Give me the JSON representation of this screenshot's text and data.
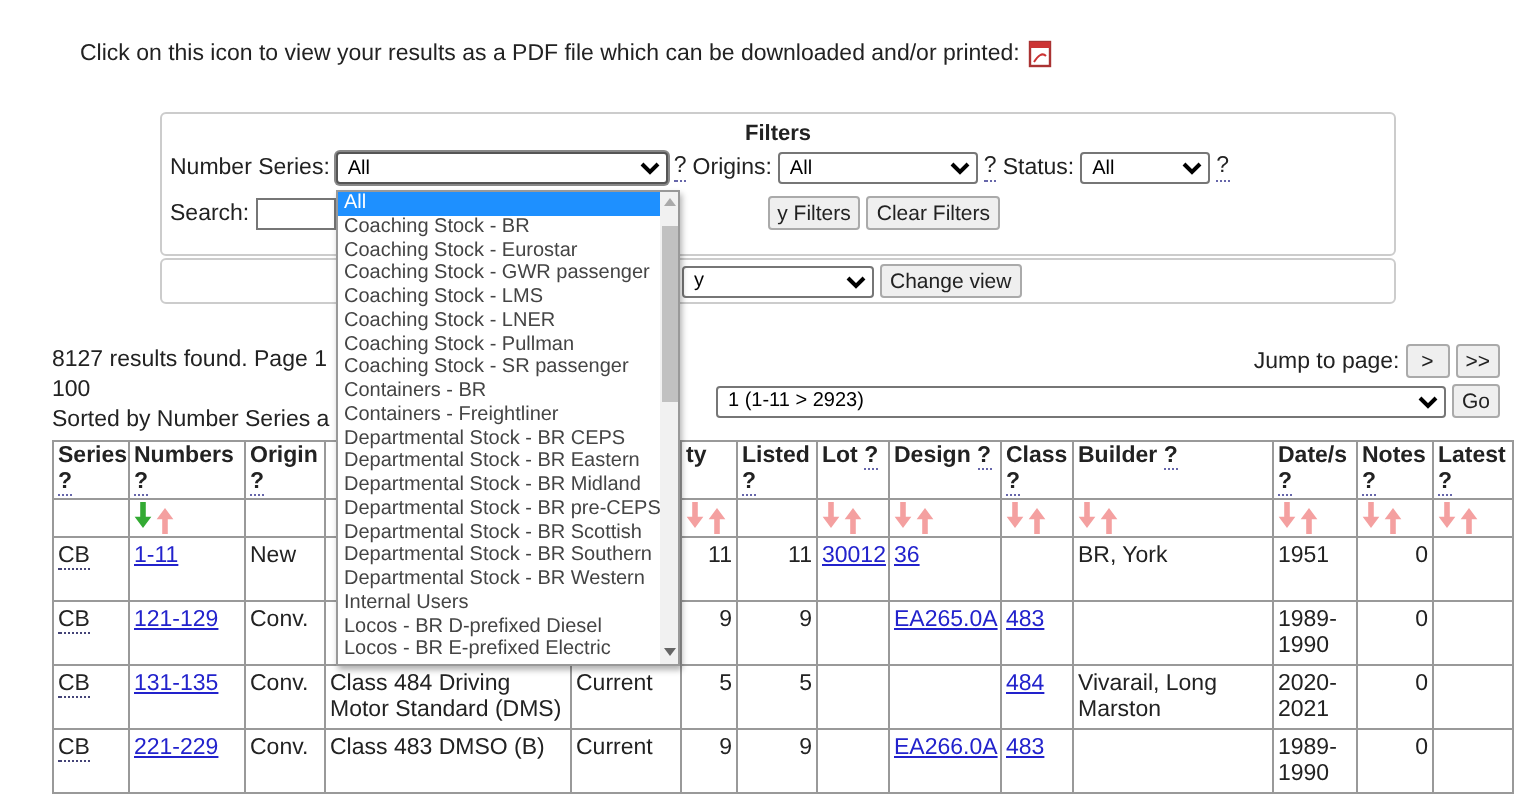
{
  "intro": {
    "text": "Click on this icon to view your results as a PDF file which can be downloaded and/or printed:"
  },
  "filters": {
    "title": "Filters",
    "selects": [
      {
        "label": "Number Series:",
        "value": "All",
        "help": "?",
        "open": true
      },
      {
        "label": "Origins:",
        "value": "All",
        "help": "?",
        "open": false
      },
      {
        "label": "Status:",
        "value": "All",
        "help": "?",
        "open": false
      }
    ],
    "search": {
      "label": "Search:"
    },
    "buttons": [
      "y Filters",
      "Clear Filters"
    ]
  },
  "view": {
    "value": "y",
    "button": "Change view"
  },
  "dropdown": {
    "options": [
      {
        "label": "All",
        "selected": true
      },
      {
        "label": "Coaching Stock - BR",
        "selected": false
      },
      {
        "label": "Coaching Stock - Eurostar",
        "selected": false
      },
      {
        "label": "Coaching Stock - GWR passenger",
        "selected": false
      },
      {
        "label": "Coaching Stock - LMS",
        "selected": false
      },
      {
        "label": "Coaching Stock - LNER",
        "selected": false
      },
      {
        "label": "Coaching Stock - Pullman",
        "selected": false
      },
      {
        "label": "Coaching Stock - SR passenger",
        "selected": false
      },
      {
        "label": "Containers - BR",
        "selected": false
      },
      {
        "label": "Containers - Freightliner",
        "selected": false
      },
      {
        "label": "Departmental Stock - BR CEPS",
        "selected": false
      },
      {
        "label": "Departmental Stock - BR Eastern",
        "selected": false
      },
      {
        "label": "Departmental Stock - BR Midland",
        "selected": false
      },
      {
        "label": "Departmental Stock - BR pre-CEPS",
        "selected": false
      },
      {
        "label": "Departmental Stock - BR Scottish",
        "selected": false
      },
      {
        "label": "Departmental Stock - BR Southern",
        "selected": false
      },
      {
        "label": "Departmental Stock - BR Western",
        "selected": false
      },
      {
        "label": "Internal Users",
        "selected": false
      },
      {
        "label": "Locos - BR D-prefixed Diesel",
        "selected": false
      },
      {
        "label": "Locos - BR E-prefixed Electric",
        "selected": false
      }
    ]
  },
  "results": {
    "summary": "8127 results found. Page 1",
    "per_page": "100",
    "sorted": "Sorted by Number Series a"
  },
  "jump": {
    "label": "Jump to page:",
    "buttons": [
      ">",
      ">>"
    ],
    "page_value": "1 (1-11 > 2923)",
    "go": "Go"
  },
  "table": {
    "columns": [
      {
        "label": "Series",
        "help": "?",
        "kind": "abbr"
      },
      {
        "label": "Numbers",
        "help": "?",
        "kind": "link",
        "sorted": true
      },
      {
        "label": "Origin",
        "help": "?",
        "kind": "text"
      },
      {
        "kind": "text"
      },
      {
        "kind": "text"
      },
      {
        "label": "ty",
        "kind": "number",
        "sorted": false
      },
      {
        "label": "Listed",
        "help": "?",
        "kind": "number"
      },
      {
        "label": "Lot",
        "help": "?",
        "help_inline": true,
        "kind": "link",
        "sorted": false
      },
      {
        "label": "Design",
        "help": "?",
        "help_inline": true,
        "kind": "link",
        "sorted": false
      },
      {
        "label": "Class",
        "help": "?",
        "kind": "link",
        "sorted": false
      },
      {
        "label": "Builder",
        "help": "?",
        "help_inline": true,
        "kind": "text",
        "sorted": false
      },
      {
        "label": "Date/s",
        "help": "?",
        "kind": "text",
        "sorted": false
      },
      {
        "label": "Notes",
        "help": "?",
        "kind": "number",
        "sorted": false
      },
      {
        "label": "Latest",
        "help": "?",
        "kind": "text",
        "sorted": false
      }
    ],
    "rows": [
      {
        "cells": [
          "CB",
          "1-11",
          "New",
          null,
          null,
          "11",
          "11",
          "30012",
          "36",
          null,
          "BR, York",
          "1951",
          "0",
          null
        ]
      },
      {
        "cells": [
          "CB",
          "121-129",
          "Conv.",
          null,
          null,
          "9",
          "9",
          null,
          "EA265.0A",
          "483",
          null,
          "1989-1990",
          "0",
          null
        ]
      },
      {
        "cells": [
          "CB",
          "131-135",
          "Conv.",
          "Class 484 Driving Motor Standard (DMS)",
          "Current",
          "5",
          "5",
          null,
          null,
          "484",
          "Vivarail, Long Marston",
          "2020-2021",
          "0",
          null
        ]
      },
      {
        "cells": [
          "CB",
          "221-229",
          "Conv.",
          "Class 483 DMSO (B)",
          "Current",
          "9",
          "9",
          null,
          "EA266.0A",
          "483",
          null,
          "1989-1990",
          "0",
          null
        ]
      }
    ]
  }
}
